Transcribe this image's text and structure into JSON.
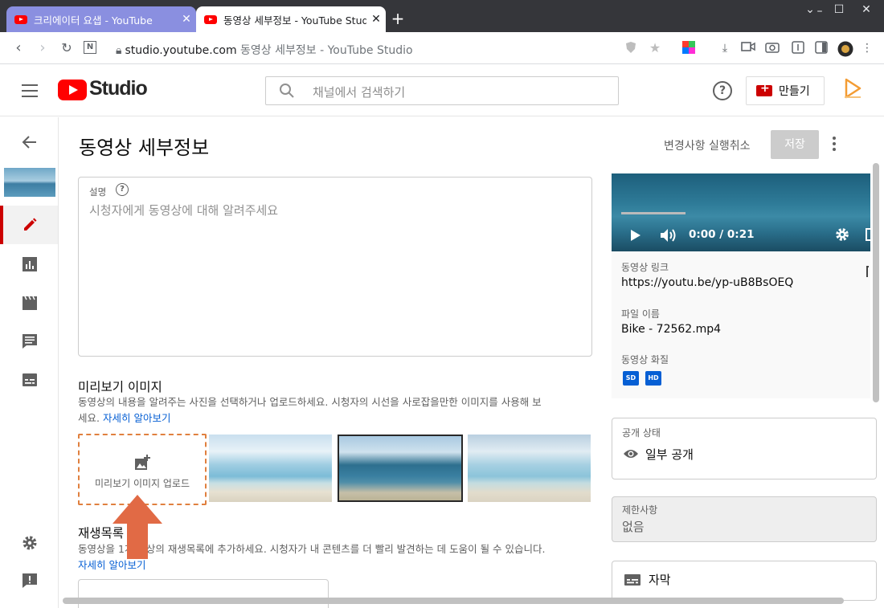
{
  "browser": {
    "tabs": [
      {
        "title": "크리에이터 요샙 - YouTube"
      },
      {
        "title": "동영상 세부정보 - YouTube Studio"
      }
    ],
    "url_host": "studio.youtube.com",
    "url_title": "동영상 세부정보 - YouTube Studio"
  },
  "header": {
    "logo_text": "Studio",
    "search_placeholder": "채널에서 검색하기",
    "create_label": "만들기"
  },
  "page": {
    "title": "동영상 세부정보",
    "undo_label": "변경사항 실행취소",
    "save_label": "저장"
  },
  "description": {
    "label": "설명",
    "placeholder": "시청자에게 동영상에 대해 알려주세요"
  },
  "thumbnail": {
    "title": "미리보기 이미지",
    "desc_line1": "동영상의 내용을 알려주는 사진을 선택하거나 업로드하세요. 시청자의 시선을 사로잡을만한 이미지를 사용해 보",
    "desc_line2": "세요.",
    "learn_more": "자세히 알아보기",
    "upload_label": "미리보기 이미지 업로드"
  },
  "playlist": {
    "title": "재생목록",
    "desc_start": "동영상을 1개 이상의 재생목록에 추가하세요. 시청자가 내 콘텐츠를 더 빨리 발견하는 데 도움이 될 수 있습니다.",
    "learn_more": "자세히 알아보기"
  },
  "video_panel": {
    "time": "0:00 / 0:21",
    "link_label": "동영상 링크",
    "link_value": "https://youtu.be/yp-uB8BsOEQ",
    "file_label": "파일 이름",
    "file_value": "Bike - 72562.mp4",
    "quality_label": "동영상 화질",
    "badges": [
      "SD",
      "HD"
    ]
  },
  "visibility": {
    "label": "공개 상태",
    "value": "일부 공개"
  },
  "restrictions": {
    "label": "제한사항",
    "value": "없음"
  },
  "subtitles": {
    "label": "자막"
  },
  "colors": {
    "brand_red": "#ff0000",
    "link_blue": "#065fd4",
    "highlight_orange": "#e0803f"
  }
}
